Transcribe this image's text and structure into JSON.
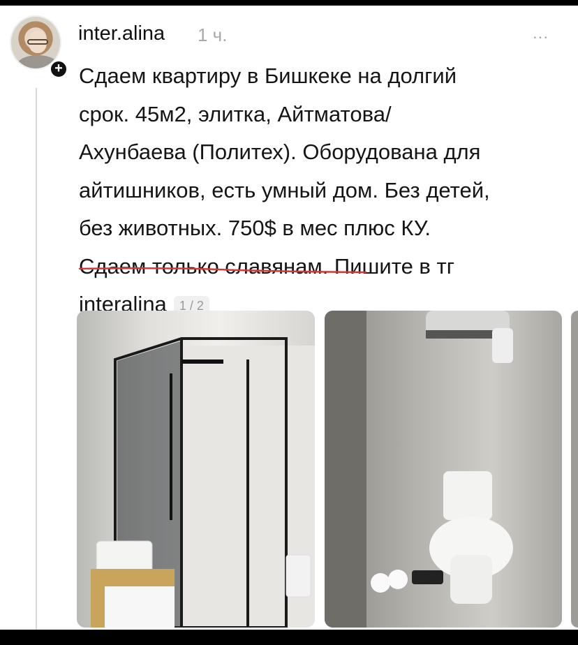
{
  "post": {
    "username": "inter.alina",
    "time": "1 ч.",
    "more_icon": "...",
    "text_lines": [
      "Сдаем квартиру в Бишкеке на долгий",
      "срок. 45м2, элитка, Айтматова/",
      "Ахунбаева (Политех). Оборудована для",
      "айтишников, есть умный дом. Без детей,",
      "без животных. 750$ в мес плюс КУ.",
      "Сдаем только славянам.  Пишите в тг",
      "interalina"
    ],
    "photo_counter": "1 / 2"
  },
  "colors": {
    "text": "#151515",
    "muted": "#a9a9a9",
    "underline": "#d23a3a"
  }
}
